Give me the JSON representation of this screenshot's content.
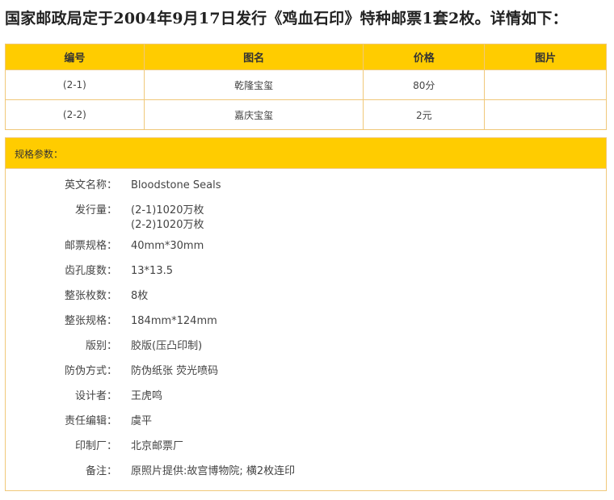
{
  "headline": "国家邮政局定于2004年9月17日发行《鸡血石印》特种邮票1套2枚。详情如下：",
  "stamp_table": {
    "headers": [
      "编号",
      "图名",
      "价格",
      "图片"
    ],
    "rows": [
      {
        "code": "(2-1)",
        "name": "乾隆宝玺",
        "price": "80分",
        "image": ""
      },
      {
        "code": "(2-2)",
        "name": "嘉庆宝玺",
        "price": "2元",
        "image": ""
      }
    ]
  },
  "specs": {
    "title": "规格参数：",
    "items": [
      {
        "label": "英文名称：",
        "value": "Bloodstone Seals"
      },
      {
        "label": "发行量：",
        "value": "(2-1)1020万枚",
        "value2": "(2-2)1020万枚"
      },
      {
        "label": "邮票规格：",
        "value": "40mm*30mm"
      },
      {
        "label": "齿孔度数：",
        "value": "13*13.5"
      },
      {
        "label": "整张枚数：",
        "value": "8枚"
      },
      {
        "label": "整张规格：",
        "value": "184mm*124mm"
      },
      {
        "label": "版别：",
        "value": "胶版(压凸印制)"
      },
      {
        "label": "防伪方式：",
        "value": "防伪纸张 荧光喷码"
      },
      {
        "label": "设计者：",
        "value": "王虎鸣"
      },
      {
        "label": "责任编辑：",
        "value": "虞平"
      },
      {
        "label": "印制厂：",
        "value": "北京邮票厂"
      },
      {
        "label": "备注：",
        "value": "原照片提供:故宫博物院; 横2枚连印"
      }
    ]
  },
  "colors": {
    "header_bg": "#ffcc00",
    "border": "#f0c87a"
  }
}
